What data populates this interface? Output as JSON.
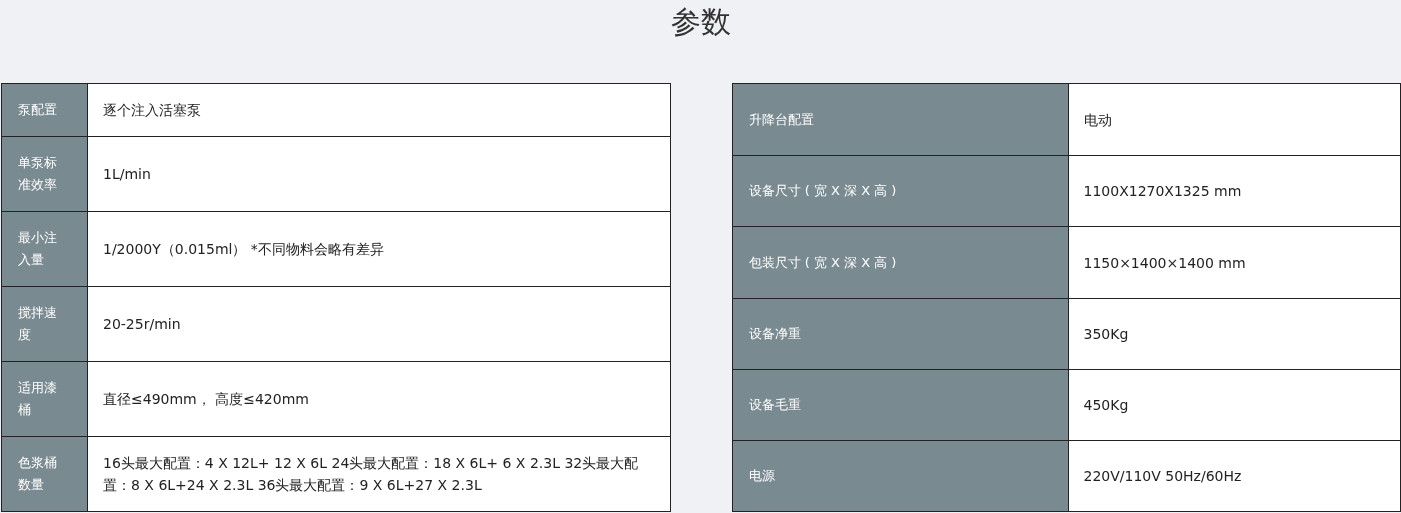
{
  "title": "参数",
  "left_table": {
    "rows": [
      {
        "label": "泵配置",
        "value": "逐个注入活塞泵"
      },
      {
        "label": "单泵标准效率",
        "value": "1L/min"
      },
      {
        "label": "最小注入量",
        "value": "1/2000Y（0.015ml） *不同物料会略有差异"
      },
      {
        "label": "搅拌速度",
        "value": "20-25r/min"
      },
      {
        "label": "适用漆桶",
        "value": "直径≤490mm， 高度≤420mm"
      },
      {
        "label": "色浆桶数量",
        "value": "16头最大配置：4 X 12L+ 12 X 6L 24头最大配置：18 X 6L+ 6 X 2.3L 32头最大配置：8 X 6L+24 X 2.3L 36头最大配置：9 X 6L+27 X 2.3L"
      }
    ]
  },
  "right_table": {
    "rows": [
      {
        "label": "升降台配置",
        "value": "电动"
      },
      {
        "label": "设备尺寸 ( 宽 X 深 X 高 )",
        "value": "1100X1270X1325 mm"
      },
      {
        "label": "包装尺寸 ( 宽 X 深 X 高 )",
        "value": "1150×1400×1400 mm"
      },
      {
        "label": "设备净重",
        "value": "350Kg"
      },
      {
        "label": "设备毛重",
        "value": "450Kg"
      },
      {
        "label": "电源",
        "value": "220V/110V 50Hz/60Hz"
      }
    ]
  }
}
